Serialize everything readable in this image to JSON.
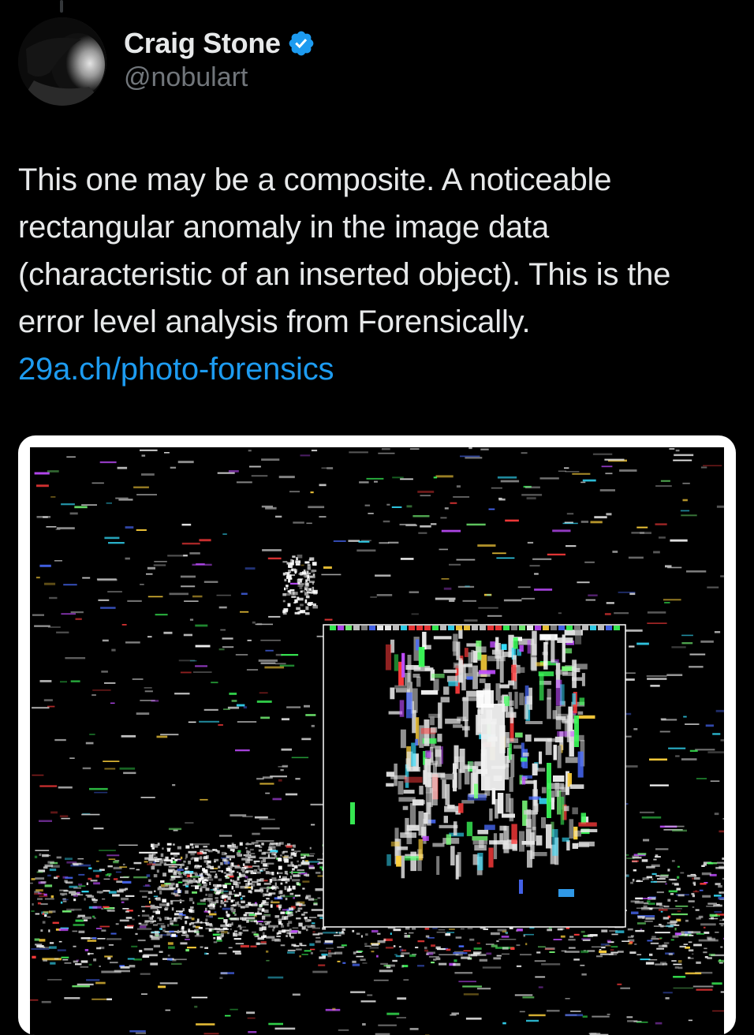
{
  "tweet": {
    "author": {
      "display_name": "Craig Stone",
      "handle": "@nobulart",
      "verified": true,
      "verified_color": "#1d9bf0",
      "avatar_icon": "profile-photo"
    },
    "text_paragraph": "This one may be a composite. A noticeable rectangular anomaly in the image data (characteristic of an inserted object). This is the error level analysis from Forensically.",
    "link_text": "29a.ch/photo-forensics",
    "link_color": "#1d9bf0",
    "media": {
      "kind": "error-level-analysis-image"
    }
  },
  "colors": {
    "background": "#000000",
    "primary_text": "#e7e9ea",
    "secondary_text": "#71767b",
    "accent": "#1d9bf0"
  }
}
